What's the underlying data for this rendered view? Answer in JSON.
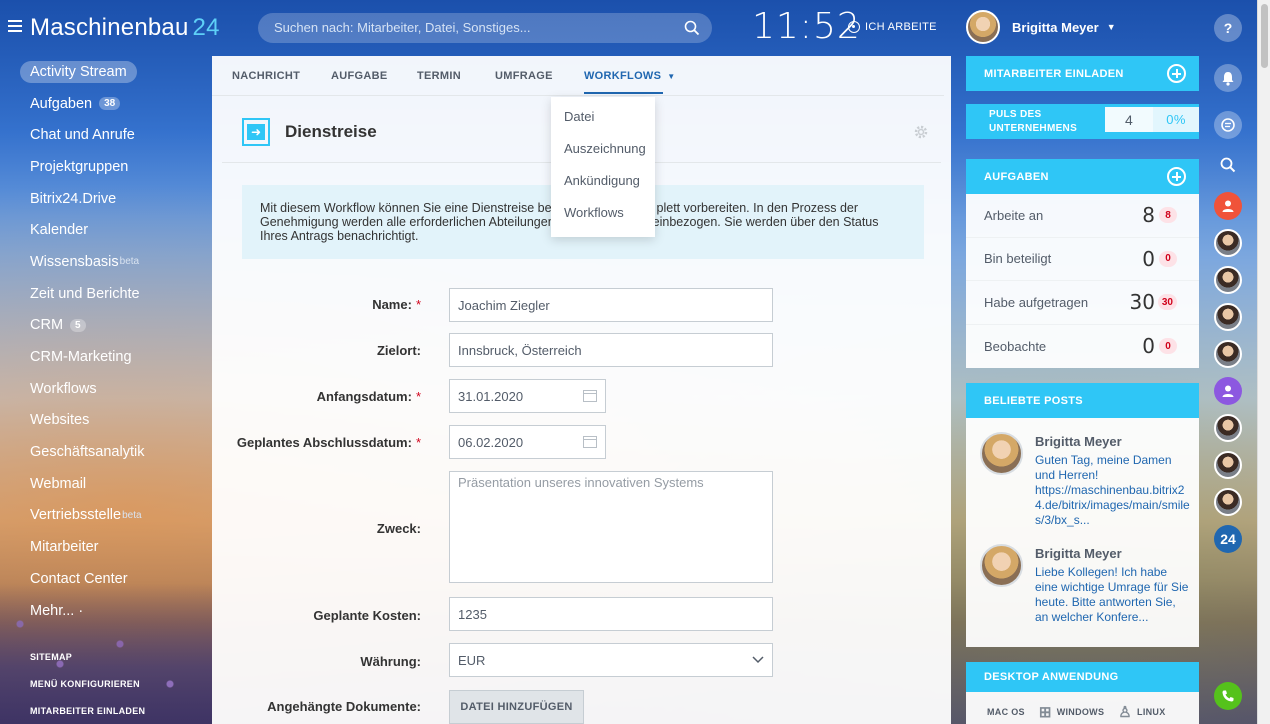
{
  "header": {
    "logo_name": "Maschinenbau",
    "logo_num": "24",
    "search_placeholder": "Suchen nach: Mitarbeiter, Datei, Sonstiges...",
    "clock": "11:52",
    "work_status": "ICH ARBEITE",
    "user_name": "Brigitta Meyer"
  },
  "left_menu": {
    "items": [
      {
        "label": "Activity Stream"
      },
      {
        "label": "Aufgaben",
        "badge": "38"
      },
      {
        "label": "Chat und Anrufe"
      },
      {
        "label": "Projektgruppen"
      },
      {
        "label": "Bitrix24.Drive"
      },
      {
        "label": "Kalender"
      },
      {
        "label": "Wissensbasis",
        "sup": "beta"
      },
      {
        "label": "Zeit und Berichte"
      },
      {
        "label": "CRM",
        "badge": "5"
      },
      {
        "label": "CRM-Marketing"
      },
      {
        "label": "Workflows"
      },
      {
        "label": "Websites"
      },
      {
        "label": "Geschäftsanalytik"
      },
      {
        "label": "Webmail"
      },
      {
        "label": "Vertriebsstelle",
        "sup": "beta"
      },
      {
        "label": "Mitarbeiter"
      },
      {
        "label": "Contact Center"
      },
      {
        "label": "Mehr... ·"
      }
    ],
    "sitemap": "SITEMAP",
    "configure": "MENÜ KONFIGURIEREN",
    "invite": "MITARBEITER EINLADEN"
  },
  "tabs": {
    "nachricht": "NACHRICHT",
    "aufgabe": "AUFGABE",
    "termin": "TERMIN",
    "umfrage": "UMFRAGE",
    "workflows": "WORKFLOWS"
  },
  "dropdown": {
    "options": [
      "Datei",
      "Auszeichnung",
      "Ankündigung",
      "Workflows"
    ]
  },
  "workflow": {
    "title": "Dienstreise",
    "info_line1": "Mit diesem Workflow können Sie eine Dienstreise bea",
    "info_line1_tail": "plett vorbereiten. In den Prozess der",
    "info_line2": "Genehmigung werden alle erforderlichen Abteilungen",
    "info_line2_tail": "einbezogen. Sie werden über den Status",
    "info_line3": "Ihres Antrags benachrichtigt.",
    "form": {
      "name_label": "Name:",
      "name_value": "Joachim Ziegler",
      "zielort_label": "Zielort:",
      "zielort_value": "Innsbruck, Österreich",
      "start_label": "Anfangsdatum:",
      "start_value": "31.01.2020",
      "end_label": "Geplantes Abschlussdatum:",
      "end_value": "06.02.2020",
      "zweck_label": "Zweck:",
      "zweck_value": "Präsentation unseres innovativen Systems",
      "kosten_label": "Geplante Kosten:",
      "kosten_value": "1235",
      "waehrung_label": "Währung:",
      "waehrung_value": "EUR",
      "docs_label": "Angehängte Dokumente:",
      "docs_button": "DATEI HINZUFÜGEN"
    }
  },
  "right_col": {
    "invite_header": "MITARBEITER EINLADEN",
    "pulse_line1": "PULS DES",
    "pulse_line2": "UNTERNEHMENS",
    "pulse_value": "4",
    "pulse_percent": "0%",
    "tasks_header": "AUFGABEN",
    "tasks": [
      {
        "label": "Arbeite an",
        "num": "8",
        "count": "8"
      },
      {
        "label": "Bin beteiligt",
        "num": "0",
        "count": "0"
      },
      {
        "label": "Habe aufgetragen",
        "num": "30",
        "count": "30"
      },
      {
        "label": "Beobachte",
        "num": "0",
        "count": "0"
      }
    ],
    "posts_header": "BELIEBTE POSTS",
    "posts": [
      {
        "author": "Brigitta Meyer",
        "text": "Guten Tag, meine Damen und Herren! https://maschinenbau.bitrix24.de/bitrix/images/main/smiles/3/bx_s..."
      },
      {
        "author": "Brigitta Meyer",
        "text": "Liebe Kollegen! Ich habe eine wichtige Umrage für Sie heute. Bitte antworten Sie, an welcher Konfere..."
      }
    ],
    "desktop_header": "DESKTOP ANWENDUNG",
    "desktop_os": [
      "MAC OS",
      "WINDOWS",
      "LINUX"
    ]
  },
  "rightbar": {
    "help": "?",
    "b24": "24"
  },
  "colors": {
    "accent": "#2fc6f6",
    "link": "#2067b0",
    "badge_red": "#d0021b"
  }
}
